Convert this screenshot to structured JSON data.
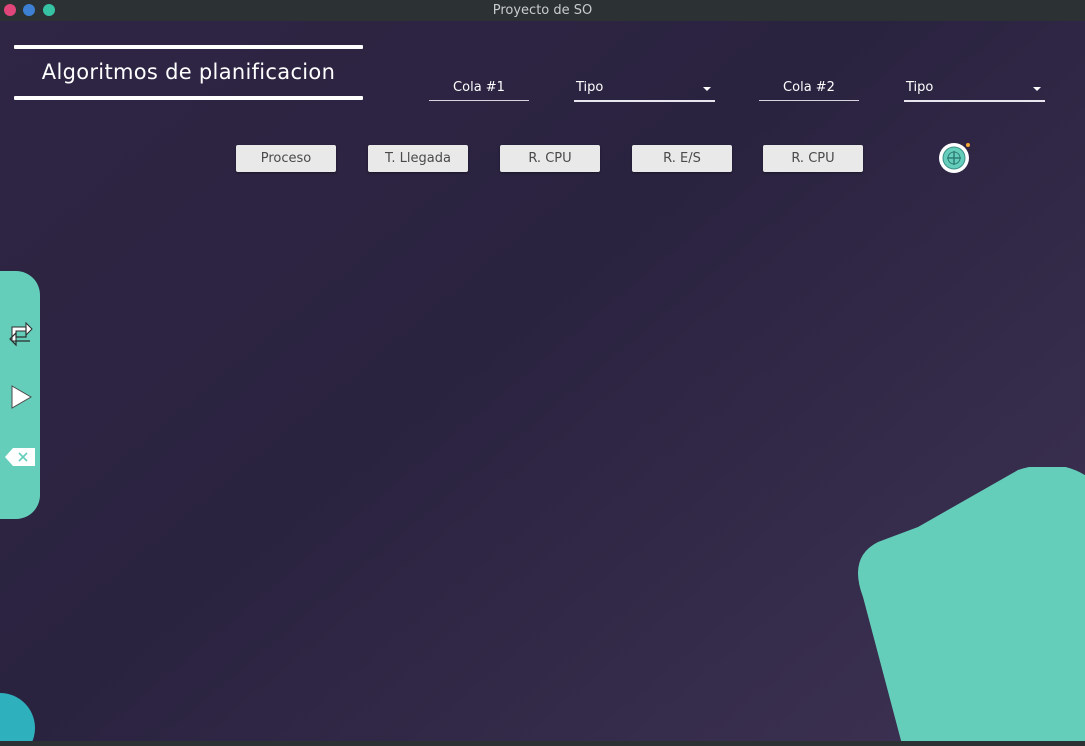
{
  "window": {
    "title": "Proyecto de SO",
    "controls": {
      "close_color": "#e0467a",
      "minimize_color": "#3d7fd3",
      "maximize_color": "#36c3a4"
    }
  },
  "heading": "Algoritmos de planificacion",
  "queues": {
    "cola1": {
      "label": "Cola #1",
      "type": "Tipo"
    },
    "cola2": {
      "label": "Cola #2",
      "type": "Tipo"
    }
  },
  "table_headers": [
    "Proceso",
    "T. Llegada",
    "R. CPU",
    "R. E/S",
    "R. CPU"
  ],
  "side_panel": {
    "icons": [
      "swap-icon",
      "play-icon",
      "backspace-icon"
    ],
    "color": "#65cebb"
  },
  "accents": {
    "teal": "#65cebb",
    "corner_circle": "#2fb0bd",
    "add_icon": "add-process-icon"
  }
}
